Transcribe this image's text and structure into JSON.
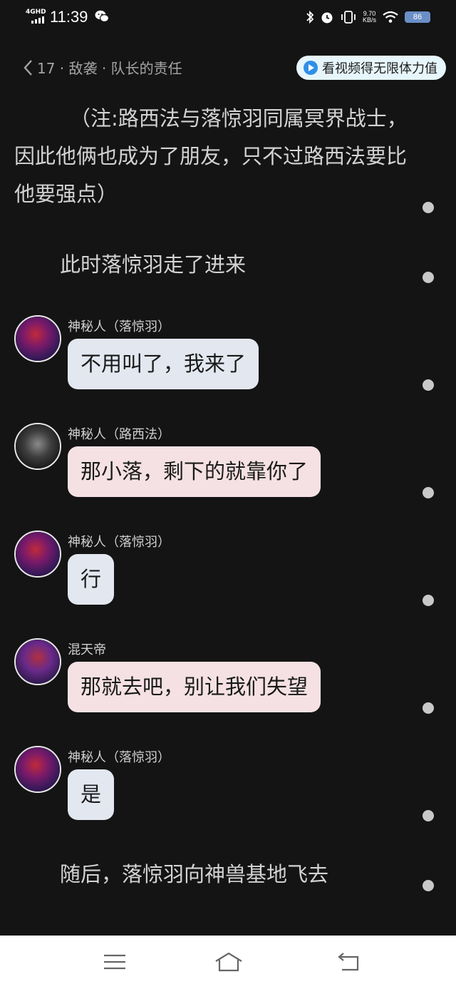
{
  "status_bar": {
    "network": "4GHD",
    "time": "11:39",
    "speed_value": "9.70",
    "speed_unit": "KB/s",
    "battery": "86"
  },
  "header": {
    "chapter_title": "17 · 敌袭 · 队长的责任",
    "promo_label": "看视频得无限体力值"
  },
  "story": {
    "narration_1": "（注:路西法与落惊羽同属冥界战士，因此他俩也成为了朋友，只不过路西法要比他要强点）",
    "narration_2": "此时落惊羽走了进来",
    "messages": [
      {
        "speaker": "神秘人（落惊羽）",
        "text": "不用叫了，我来了"
      },
      {
        "speaker": "神秘人（路西法）",
        "text": "那小落，剩下的就靠你了"
      },
      {
        "speaker": "神秘人（落惊羽）",
        "text": "行"
      },
      {
        "speaker": "混天帝",
        "text": "那就去吧，别让我们失望"
      },
      {
        "speaker": "神秘人（落惊羽）",
        "text": "是"
      }
    ],
    "narration_3": "随后，落惊羽向神兽基地飞去"
  },
  "colors": {
    "background": "#141414",
    "bubble_blue": "#e2e7f0",
    "bubble_pink": "#f5e1e3",
    "promo_bg": "#e6f6fb"
  },
  "icons": [
    "wechat-icon",
    "bluetooth-icon",
    "alarm-icon",
    "vibrate-icon",
    "wifi-icon",
    "back-chevron-icon",
    "play-icon",
    "menu-icon",
    "home-icon",
    "back-icon"
  ]
}
